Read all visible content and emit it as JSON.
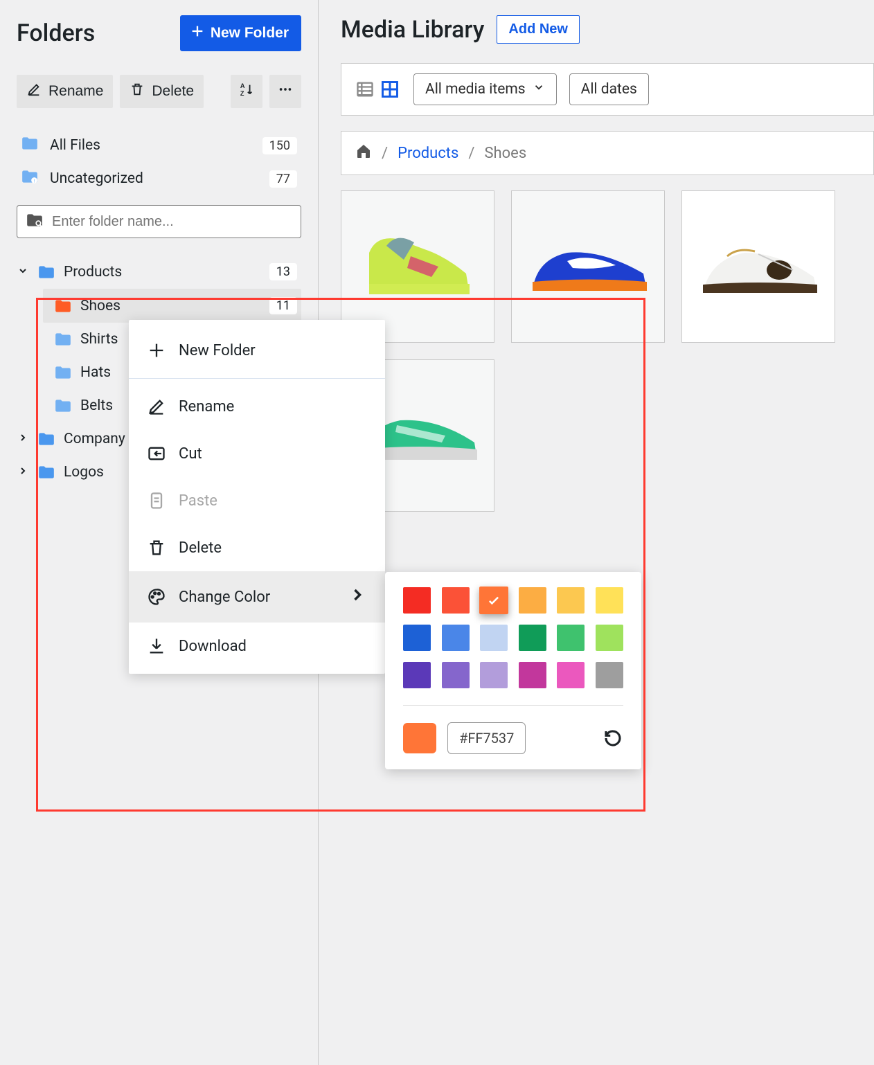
{
  "sidebar": {
    "title": "Folders",
    "new_folder_label": "New Folder",
    "toolbar": {
      "rename": "Rename",
      "delete": "Delete"
    },
    "top_items": [
      {
        "label": "All Files",
        "count": "150"
      },
      {
        "label": "Uncategorized",
        "count": "77"
      }
    ],
    "search_placeholder": "Enter folder name...",
    "tree": {
      "products": {
        "label": "Products",
        "count": "13"
      },
      "shoes": {
        "label": "Shoes",
        "count": "11"
      },
      "shirts": {
        "label": "Shirts"
      },
      "hats": {
        "label": "Hats"
      },
      "belts": {
        "label": "Belts"
      },
      "company": {
        "label": "Company P"
      },
      "logos": {
        "label": "Logos"
      }
    }
  },
  "context_menu": {
    "new_folder": "New Folder",
    "rename": "Rename",
    "cut": "Cut",
    "paste": "Paste",
    "delete": "Delete",
    "change_color": "Change Color",
    "download": "Download"
  },
  "color_picker": {
    "swatches": [
      "#f42c23",
      "#fb5237",
      "#ff7537",
      "#fcad43",
      "#fcc850",
      "#ffe158",
      "#1d61d6",
      "#4a86e8",
      "#c1d4f2",
      "#109c58",
      "#3fc26e",
      "#9fe25d",
      "#5b39b8",
      "#8566cc",
      "#b29ddb",
      "#c2379c",
      "#eb58be",
      "#9e9e9e"
    ],
    "selected_index": 2,
    "hex": "#FF7537"
  },
  "main": {
    "title": "Media Library",
    "add_new": "Add New",
    "filter_media": "All media items",
    "filter_dates": "All dates",
    "breadcrumb": {
      "products": "Products",
      "shoes": "Shoes"
    }
  }
}
